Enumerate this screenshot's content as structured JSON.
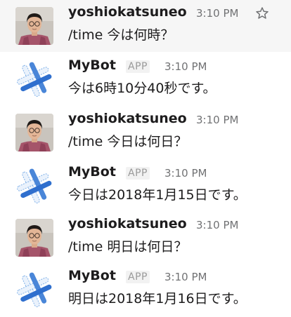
{
  "messages": [
    {
      "author": "yoshiokatsuneo",
      "time": "3:10 PM",
      "text": "/time 今は何時？",
      "is_app": false
    },
    {
      "author": "MyBot",
      "badge": "APP",
      "time": "3:10 PM",
      "text": "今は6時10分40秒です。",
      "is_app": true
    },
    {
      "author": "yoshiokatsuneo",
      "time": "3:10 PM",
      "text": "/time 今日は何日？",
      "is_app": false
    },
    {
      "author": "MyBot",
      "badge": "APP",
      "time": "3:10 PM",
      "text": "今日は2018年1月15日です。",
      "is_app": true
    },
    {
      "author": "yoshiokatsuneo",
      "time": "3:10 PM",
      "text": "/time 明日は何日？",
      "is_app": false
    },
    {
      "author": "MyBot",
      "badge": "APP",
      "time": "3:10 PM",
      "text": "明日は2018年1月16日です。",
      "is_app": true
    }
  ],
  "icons": {
    "star": "star-outline-icon",
    "user_avatar": "user-photo-avatar",
    "bot_avatar": "bot-hashtag-logo"
  },
  "colors": {
    "hover_background": "#f6f6f6",
    "bot_blue": "#2f6fce",
    "bot_light_blue": "#7fb0e8"
  }
}
